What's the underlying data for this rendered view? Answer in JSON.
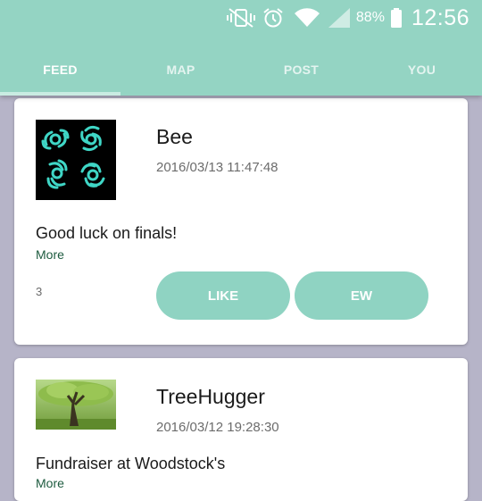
{
  "status_bar": {
    "battery_percent": "88%",
    "time": "12:56",
    "icons": [
      "vibrate-mute-icon",
      "alarm-icon",
      "wifi-icon",
      "signal-icon",
      "battery-icon"
    ]
  },
  "tabs": [
    {
      "label": "FEED",
      "active": true
    },
    {
      "label": "MAP",
      "active": false
    },
    {
      "label": "POST",
      "active": false
    },
    {
      "label": "YOU",
      "active": false
    }
  ],
  "posts": [
    {
      "username": "Bee",
      "timestamp": "2016/03/13 11:47:48",
      "text": "Good luck on finals!",
      "more_label": "More",
      "count": "3",
      "like_label": "LIKE",
      "ew_label": "EW"
    },
    {
      "username": "TreeHugger",
      "timestamp": "2016/03/12 19:28:30",
      "text": "Fundraiser at Woodstock's",
      "more_label": "More"
    }
  ],
  "colors": {
    "accent": "#94d4c3",
    "button": "#8fd3c2",
    "background": "#b6b4c8",
    "avatar_glyph": "#3fd6c6"
  }
}
